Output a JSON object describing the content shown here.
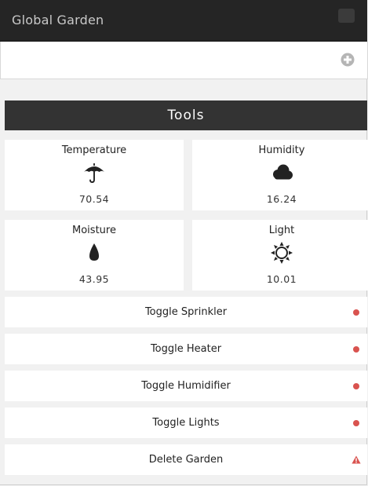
{
  "app": {
    "title": "Global Garden"
  },
  "add_bar": {
    "value": ""
  },
  "tools": {
    "title": "Tools"
  },
  "sensors": [
    {
      "label": "Temperature",
      "icon": "umbrella-icon",
      "value": "70.54"
    },
    {
      "label": "Humidity",
      "icon": "cloud-icon",
      "value": "16.24"
    },
    {
      "label": "Moisture",
      "icon": "droplet-icon",
      "value": "43.95"
    },
    {
      "label": "Light",
      "icon": "sun-icon",
      "value": "10.01"
    }
  ],
  "actions": [
    {
      "label": "Toggle Sprinkler",
      "status_icon": "status-dot-icon"
    },
    {
      "label": "Toggle Heater",
      "status_icon": "status-dot-icon"
    },
    {
      "label": "Toggle Humidifier",
      "status_icon": "status-dot-icon"
    },
    {
      "label": "Toggle Lights",
      "status_icon": "status-dot-icon"
    },
    {
      "label": "Delete Garden",
      "status_icon": "warning-icon"
    }
  ],
  "colors": {
    "header_bg": "#252525",
    "tools_bg": "#333333",
    "status_red": "#d9534f"
  }
}
